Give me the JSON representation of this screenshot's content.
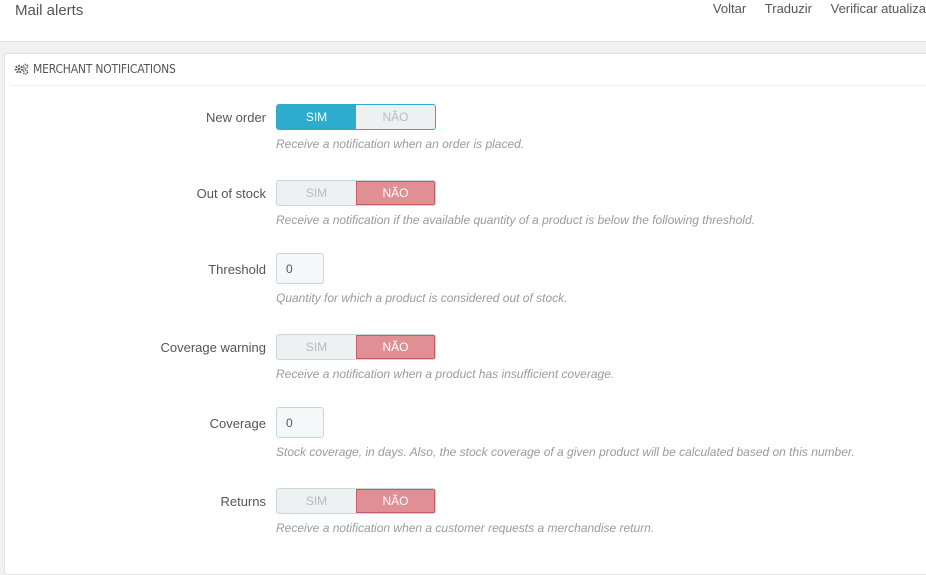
{
  "header": {
    "title": "Mail alerts",
    "actions": [
      "Voltar",
      "Traduzir",
      "Verificar atualiza"
    ]
  },
  "panel": {
    "title": "MERCHANT NOTIFICATIONS",
    "icon": "gears-icon"
  },
  "fields": {
    "new_order": {
      "label": "New order",
      "yes": "SIM",
      "no": "NÃO",
      "value": "SIM",
      "help": "Receive a notification when an order is placed."
    },
    "out_of_stock": {
      "label": "Out of stock",
      "yes": "SIM",
      "no": "NÃO",
      "value": "NÃO",
      "help": "Receive a notification if the available quantity of a product is below the following threshold."
    },
    "threshold": {
      "label": "Threshold",
      "value": "0",
      "help": "Quantity for which a product is considered out of stock."
    },
    "coverage_warning": {
      "label": "Coverage warning",
      "yes": "SIM",
      "no": "NÃO",
      "value": "NÃO",
      "help": "Receive a notification when a product has insufficient coverage."
    },
    "coverage": {
      "label": "Coverage",
      "value": "0",
      "help": "Stock coverage, in days. Also, the stock coverage of a given product will be calculated based on this number."
    },
    "returns": {
      "label": "Returns",
      "yes": "SIM",
      "no": "NÃO",
      "value": "NÃO",
      "help": "Receive a notification when a customer requests a merchandise return."
    }
  },
  "colors": {
    "accent": "#2eacce",
    "danger": "#e08f95"
  }
}
